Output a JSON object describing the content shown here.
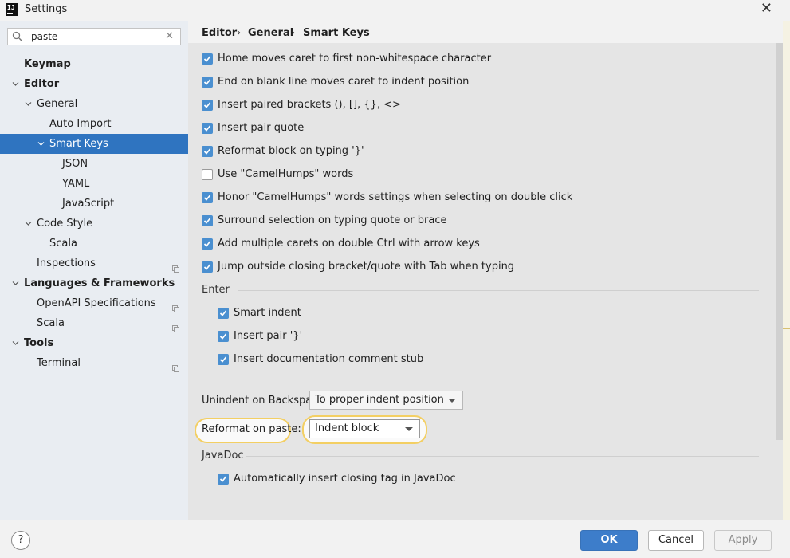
{
  "window": {
    "title": "Settings",
    "app_icon_text": "IJ"
  },
  "search": {
    "value": "paste",
    "placeholder": ""
  },
  "tree": [
    {
      "label": "Keymap",
      "bold": true
    },
    {
      "label": "Editor",
      "bold": true
    },
    {
      "label": "General"
    },
    {
      "label": "Auto Import"
    },
    {
      "label": "Smart Keys",
      "selected": true
    },
    {
      "label": "JSON"
    },
    {
      "label": "YAML"
    },
    {
      "label": "JavaScript"
    },
    {
      "label": "Code Style"
    },
    {
      "label": "Scala"
    },
    {
      "label": "Inspections"
    },
    {
      "label": "Languages & Frameworks",
      "bold": true
    },
    {
      "label": "OpenAPI Specifications"
    },
    {
      "label": "Scala"
    },
    {
      "label": "Tools",
      "bold": true
    },
    {
      "label": "Terminal"
    }
  ],
  "breadcrumb": {
    "items": [
      "Editor",
      "General",
      "Smart Keys"
    ],
    "separator": "›"
  },
  "options": [
    {
      "label": "Home moves caret to first non-whitespace character",
      "checked": true
    },
    {
      "label": "End on blank line moves caret to indent position",
      "checked": true
    },
    {
      "label": "Insert paired brackets (), [], {}, <>",
      "checked": true
    },
    {
      "label": "Insert pair quote",
      "checked": true
    },
    {
      "label": "Reformat block on typing '}'",
      "checked": true
    },
    {
      "label": "Use \"CamelHumps\" words",
      "checked": false
    },
    {
      "label": "Honor \"CamelHumps\" words settings when selecting on double click",
      "checked": true
    },
    {
      "label": "Surround selection on typing quote or brace",
      "checked": true
    },
    {
      "label": "Add multiple carets on double Ctrl with arrow keys",
      "checked": true
    },
    {
      "label": "Jump outside closing bracket/quote with Tab when typing",
      "checked": true
    }
  ],
  "enter": {
    "title": "Enter",
    "options": [
      {
        "label": "Smart indent",
        "checked": true
      },
      {
        "label": "Insert pair '}'",
        "checked": true
      },
      {
        "label": "Insert documentation comment stub",
        "checked": true
      }
    ]
  },
  "unindent": {
    "label": "Unindent on Backspace:",
    "value": "To proper indent position"
  },
  "reformat_paste": {
    "label": "Reformat on paste:",
    "value": "Indent block"
  },
  "javadoc": {
    "title": "JavaDoc",
    "options": [
      {
        "label": "Automatically insert closing tag in JavaDoc",
        "checked": true
      }
    ]
  },
  "buttons": {
    "ok": "OK",
    "cancel": "Cancel",
    "apply": "Apply",
    "help": "?"
  },
  "colors": {
    "selection": "#2f74c0",
    "highlight": "#f3cf63",
    "primary_button": "#3d7dca",
    "checkbox": "#4a8fd0"
  },
  "icons": {
    "search": "search-icon",
    "clear": "clear-icon",
    "close": "close-icon",
    "expand": "chevron-down-icon",
    "external": "project-scope-icon"
  }
}
